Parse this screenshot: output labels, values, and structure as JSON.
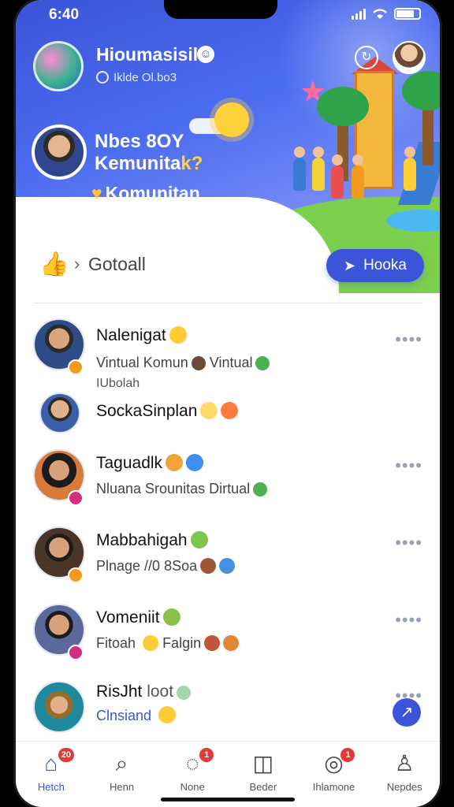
{
  "status": {
    "time": "6:40"
  },
  "header": {
    "user_name": "Hioumasisil",
    "user_subtitle": "Iklde Ol.bo3",
    "community_title_1": "Nbes 8OY",
    "community_title_2": "Kemunita",
    "community_title_accent": "k?",
    "community_tag": "Komunitan"
  },
  "breadcrumb": {
    "label": "Gotoall"
  },
  "hook_button": {
    "label": "Hooka"
  },
  "feed": [
    {
      "name": "Nalenigat",
      "line": "Vintual Komun",
      "line_b": "Vintual",
      "line3": "IUbolah",
      "avatar_color": "#2e4d86",
      "badge_color": "#f29a1c"
    },
    {
      "name": "SockaSinplan",
      "line": "",
      "line_b": "",
      "line3": "",
      "avatar_color": "#3c5fa8",
      "badge_color": ""
    },
    {
      "name": "Taguadlk",
      "line": "Nluana Srounitas Dirtual",
      "line_b": "",
      "line3": "",
      "avatar_color": "#7a3b2a",
      "badge_color": "#d02f84"
    },
    {
      "name": "Mabbahigah",
      "line": "Plnage //0 8Soa",
      "line_b": "",
      "line3": "",
      "avatar_color": "#4a3527",
      "badge_color": "#f29a1c"
    },
    {
      "name": "Vomeniit",
      "line": "Fitoah",
      "line_b": "Falgin",
      "line3": "",
      "avatar_color": "#5b6a9a",
      "badge_color": "#d02f84"
    },
    {
      "name": "RisJht",
      "line": "Clnsiand",
      "line_b": "",
      "line3": "",
      "name_suffix": "loot",
      "avatar_color": "#1e8a9c",
      "badge_color": ""
    }
  ],
  "tabs": [
    {
      "label": "Hetch",
      "icon": "home-icon",
      "badge": "20"
    },
    {
      "label": "Henn",
      "icon": "search-icon",
      "badge": ""
    },
    {
      "label": "None",
      "icon": "chat-icon",
      "badge": "1"
    },
    {
      "label": "Beder",
      "icon": "game-icon",
      "badge": ""
    },
    {
      "label": "Ihlamone",
      "icon": "notification-icon",
      "badge": "1"
    },
    {
      "label": "Nepdes",
      "icon": "profile-icon",
      "badge": ""
    }
  ],
  "colors": {
    "brand": "#3b54d9",
    "badge": "#e53935"
  }
}
